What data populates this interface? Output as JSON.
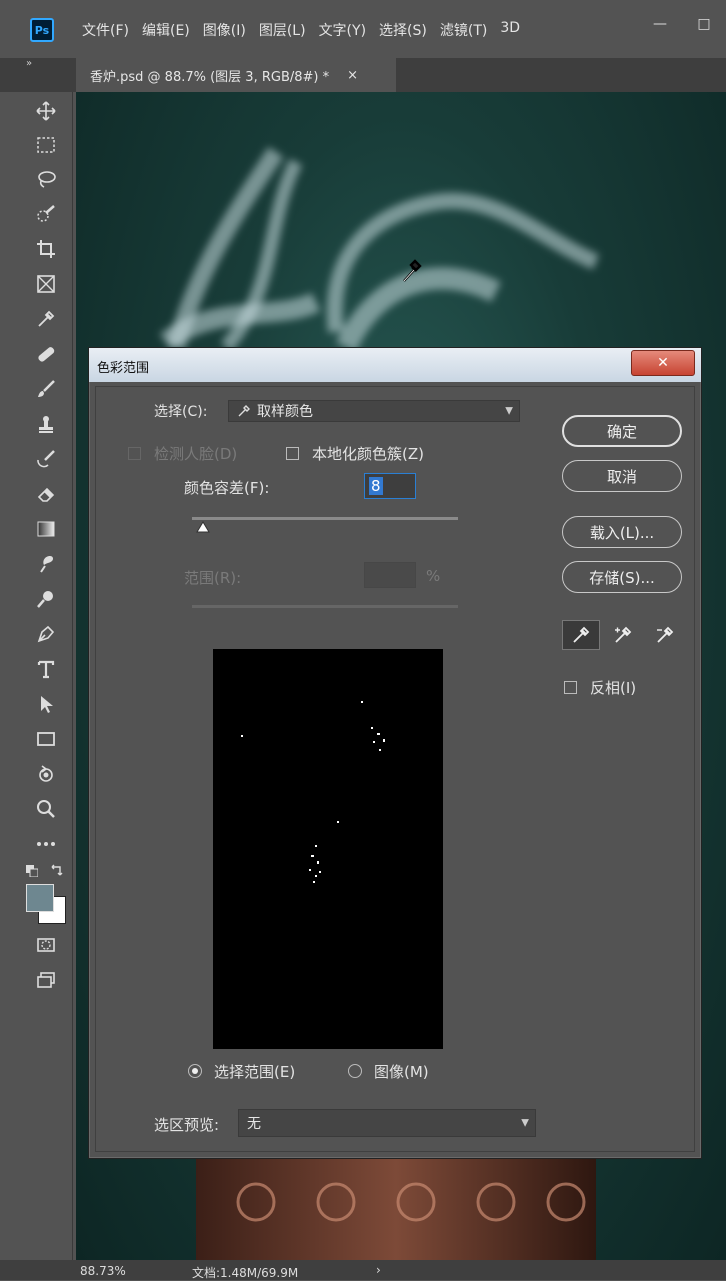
{
  "app": {
    "logo": "Ps"
  },
  "menu": [
    "文件(F)",
    "编辑(E)",
    "图像(I)",
    "图层(L)",
    "文字(Y)",
    "选择(S)",
    "滤镜(T)",
    "3D"
  ],
  "window_controls": {
    "minimize": "—",
    "maximize": "□"
  },
  "panel_collapse": "»",
  "document_tab": {
    "title": "香炉.psd @ 88.7% (图层 3, RGB/8#) *",
    "close": "×"
  },
  "toolbar": [
    "move-tool-icon",
    "marquee-tool-icon",
    "lasso-tool-icon",
    "quick-select-icon",
    "crop-tool-icon",
    "frame-tool-icon",
    "eyedropper-icon",
    "healing-brush-icon",
    "brush-icon",
    "clone-stamp-icon",
    "history-brush-icon",
    "eraser-icon",
    "gradient-icon",
    "smudge-icon",
    "dodge-icon",
    "pen-icon",
    "type-icon",
    "path-select-icon",
    "rectangle-icon",
    "hand-rotate-icon",
    "zoom-icon",
    "more-tools-icon"
  ],
  "colors": {
    "foreground": "#6e8790",
    "background": "#ffffff"
  },
  "dialog": {
    "title": "色彩范围",
    "close": "✕",
    "select_label": "选择(C):",
    "select_value": "取样颜色",
    "detect_faces": "检测人脸(D)",
    "localized_clusters": "本地化颜色簇(Z)",
    "fuzziness_label": "颜色容差(F):",
    "fuzziness_value": "8",
    "fuzziness_fraction": 0.04,
    "range_label": "范围(R):",
    "range_unit": "%",
    "radio_selection": "选择范围(E)",
    "radio_image": "图像(M)",
    "preview_label": "选区预览:",
    "preview_value": "无",
    "ok": "确定",
    "cancel": "取消",
    "load": "载入(L)...",
    "save": "存储(S)...",
    "invert": "反相(I)"
  },
  "status": {
    "zoom": "88.73%",
    "doc": "文档:1.48M/69.9M",
    "arrow": "›"
  }
}
